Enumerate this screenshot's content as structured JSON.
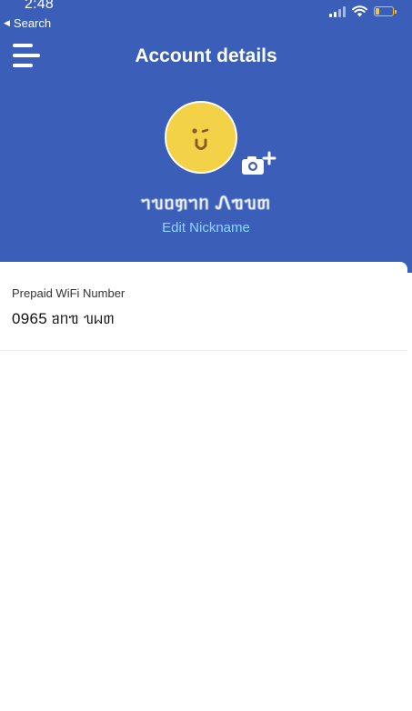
{
  "status_bar": {
    "time": "2:48",
    "back_label": "Search",
    "back_icon": "triangle-left-icon",
    "signal_icon": "cellular-signal-icon",
    "wifi_icon": "wifi-icon",
    "battery_icon": "battery-low-icon",
    "battery_color": "#f3c23b"
  },
  "header": {
    "title": "Account details",
    "background_color": "#3b5fb8",
    "menu_icon": "hamburger-menu-icon"
  },
  "profile": {
    "avatar_icon": "winking-face-icon",
    "avatar_color": "#f4d247",
    "camera_icon": "camera-add-icon",
    "nickname": "ᥐᥔᥝᥞᥐᥒ Ꮑᥓᥔᥖ",
    "edit_label": "Edit Nickname",
    "edit_color": "#8fd6ff"
  },
  "account": {
    "label": "Prepaid WiFi Number",
    "value": "0965 ᥑᥒᥓ ᥔᥕᥖ"
  }
}
